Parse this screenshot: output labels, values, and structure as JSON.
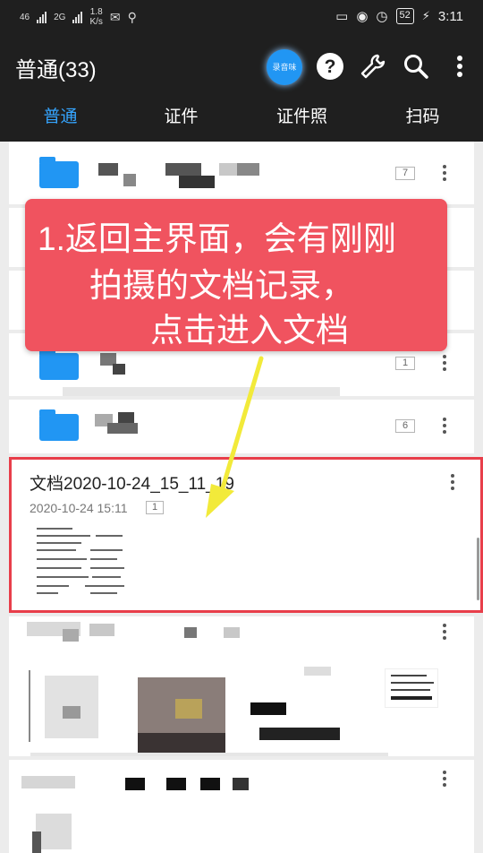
{
  "status_bar": {
    "net1": "46",
    "net2": "2G",
    "speed_value": "1.8",
    "speed_unit": "K/s",
    "battery": "52",
    "time": "3:11"
  },
  "app_bar": {
    "title": "普通(33)",
    "bubble_label": "录音味",
    "icons": [
      "help-icon",
      "wrench-icon",
      "search-icon",
      "more-vertical-icon"
    ]
  },
  "tabs": [
    {
      "label": "普通",
      "active": true
    },
    {
      "label": "证件",
      "active": false
    },
    {
      "label": "证件照",
      "active": false
    },
    {
      "label": "扫码",
      "active": false
    }
  ],
  "list": {
    "folder_counts": [
      "7",
      "1",
      "6"
    ],
    "highlighted_doc": {
      "name": "文档2020-10-24_15_11_19",
      "date": "2020-10-24 15:11",
      "pages": "1"
    }
  },
  "callout": {
    "line1": "1.返回主界面，会有刚刚",
    "line2": "拍摄的文档记录，",
    "line3": "点击进入文档"
  },
  "colors": {
    "bar_bg": "#1f1f1f",
    "accent": "#35a5ff",
    "folder": "#2196f3",
    "callout": "#f0535f",
    "highlight_border": "#e83e4a",
    "arrow": "#f2ea3a"
  }
}
